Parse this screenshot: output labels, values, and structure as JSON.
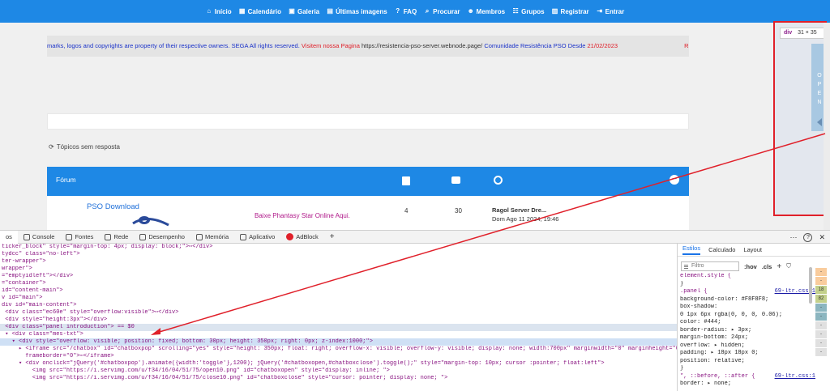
{
  "topnav": {
    "items": [
      {
        "label": "Início",
        "icon": "home-icon"
      },
      {
        "label": "Calendário",
        "icon": "calendar-icon"
      },
      {
        "label": "Galeria",
        "icon": "gallery-icon"
      },
      {
        "label": "Últimas imagens",
        "icon": "images-icon"
      },
      {
        "label": "FAQ",
        "icon": "help-icon"
      },
      {
        "label": "Procurar",
        "icon": "search-icon"
      },
      {
        "label": "Membros",
        "icon": "members-icon"
      },
      {
        "label": "Grupos",
        "icon": "groups-icon"
      },
      {
        "label": "Registrar",
        "icon": "register-icon"
      },
      {
        "label": "Entrar",
        "icon": "login-icon"
      }
    ],
    "color": "#1e88e5"
  },
  "ticker": {
    "part1": "marks, logos and copyrights are property of their respective owners. SEGA All rights reserved.",
    "part2": "Visitem nossa Pagina",
    "part3": "https://resistencia-pso-server.webnode.page/",
    "part4": "Comunidade Resistência PSO Desde",
    "part5": "21/02/2023",
    "part6": "Re"
  },
  "no_reply": "Tópicos sem resposta",
  "forum": {
    "header_label": "Fórum",
    "row": {
      "title": "PSO Download",
      "description": "Baixe Phantasy Star Online Aqui.",
      "topics": "4",
      "posts": "30",
      "last_title": "Ragol Server Dre...",
      "last_date": "Dom Ago 11 2024, 19:46"
    }
  },
  "inspector_tip": {
    "tag": "div",
    "size": "31 × 35"
  },
  "chatbox_open": "O P E N",
  "devtools": {
    "tabs": [
      {
        "label": "os",
        "active": true
      },
      {
        "label": "Console"
      },
      {
        "label": "Fontes"
      },
      {
        "label": "Rede"
      },
      {
        "label": "Desempenho"
      },
      {
        "label": "Memória"
      },
      {
        "label": "Aplicativo"
      },
      {
        "label": "AdBlock"
      }
    ],
    "add_tab": "+",
    "right": {
      "more": "⋯",
      "help": "?",
      "close": "✕"
    },
    "dom_lines": [
      "ticker_block\" style=\"margin-top: 4px; display: block;\">⋯</div>",
      "tydcc\" class=\"no-left\">",
      "ter-wrapper\">",
      "wrapper\">",
      "=\"emptyidleft\"></div>",
      "=\"container\">",
      "id=\"content-main\">",
      "v id=\"main\">",
      "div id=\"main-content\">",
      " <div class=\"ec60e\" style=\"overflow:visible\">⋯</div>",
      " <div style=\"height:3px\"></div>",
      " <div class=\"panel introduction\"> == $0",
      " ▾ <div class=\"mes-txt\">",
      "   ▾ <div style=\"overflow: visible; position: fixed; bottom: 30px; height: 350px; right: 0px; z-index:1000;\">",
      "     ▸ <iframe src=\"/chatbox\" id=\"chatboxpop\" scrolling=\"yes\" style=\"height: 350px; float: right; overflow-x: visible; overflow-y: visible; display: none; width:700px\" marginwidth=\"0\" marginheight=\"0\"",
      "       frameborder=\"0\">⋯</iframe>",
      "     ▾ <div onclick=\"jQuery('#chatboxpop').animate({width:'toggle'},1200); jQuery('#chatboxopen,#chatboxclose').toggle();\" style=\"margin-top: 10px; cursor :pointer; float:left\">",
      "         <img src=\"https://i.servimg.com/u/f34/16/04/51/75/open10.png\" id=\"chatboxopen\" style=\"display: inline; \">",
      "         <img src=\"https://i.servimg.com/u/f34/16/04/51/75/close10.png\" id=\"chatboxclose\" style=\"cursor: pointer; display: none; \">"
    ],
    "styles_panel": {
      "tabs": [
        "Estilos",
        "Calculado",
        "Layout"
      ],
      "filter_placeholder": "Filtro",
      "hov": ":hov",
      "cls": ".cls",
      "rules": [
        "element.style {",
        "}",
        ".panel {",
        "  background-color: #F8F8F8;",
        "  box-shadow:",
        "    0 1px 6px rgba(0, 0, 0, 0.06);",
        "  color: #444;",
        "  border-radius: ▸ 3px;",
        "  margin-bottom: 24px;",
        "  overflow: ▸ hidden;",
        "  padding: ▸ 18px 18px 0;",
        "  position: relative;",
        "}",
        "*, ::before, ::after {",
        "  border: ▸ none;"
      ],
      "source": "69-ltr.css:1",
      "boxmodel": [
        "-",
        "-",
        "18",
        "82",
        "-",
        "-",
        "-",
        "-",
        "-",
        "-"
      ]
    }
  }
}
